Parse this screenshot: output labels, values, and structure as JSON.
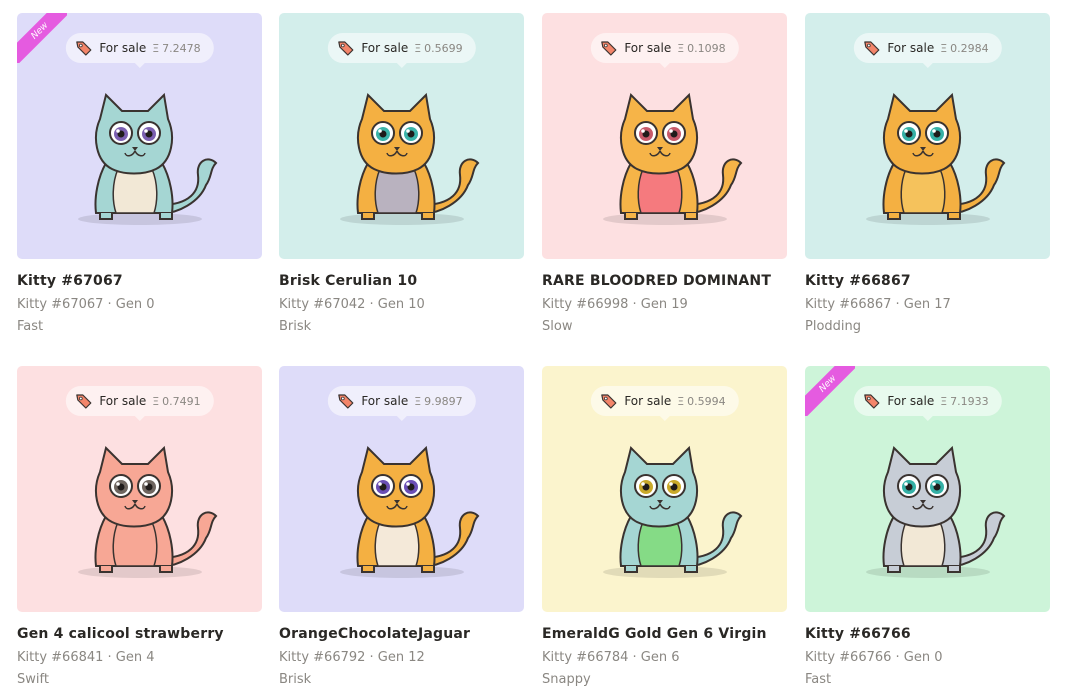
{
  "sale_label": "For sale",
  "eth_symbol": "Ξ",
  "new_label": "New",
  "kitties": [
    {
      "name": "Kitty #67067",
      "id_gen": "Kitty #67067 · Gen 0",
      "speed": "Fast",
      "price": "7.2478",
      "bg": "#dedcf9",
      "body": "#a5d6d3",
      "belly": "#f2e8d6",
      "eye": "#7b5fb1",
      "is_new": true
    },
    {
      "name": "Brisk Cerulian 10",
      "id_gen": "Kitty #67042 · Gen 10",
      "speed": "Brisk",
      "price": "0.5699",
      "bg": "#d3eeeb",
      "body": "#f4b042",
      "belly": "#b9b2bf",
      "eye": "#3bb3a9",
      "is_new": false
    },
    {
      "name": "RARE BLOODRED DOMINANT",
      "id_gen": "Kitty #66998 · Gen 19",
      "speed": "Slow",
      "price": "0.1098",
      "bg": "#fde0e1",
      "body": "#f6b448",
      "belly": "#f57a7e",
      "eye": "#c85a6a",
      "is_new": false
    },
    {
      "name": "Kitty #66867",
      "id_gen": "Kitty #66867 · Gen 17",
      "speed": "Plodding",
      "price": "0.2984",
      "bg": "#d3eeeb",
      "body": "#f4b042",
      "belly": "#f5c25c",
      "eye": "#35b0a6",
      "is_new": false
    },
    {
      "name": "Gen 4 calicool strawberry",
      "id_gen": "Kitty #66841 · Gen 4",
      "speed": "Swift",
      "price": "0.7491",
      "bg": "#fde0e1",
      "body": "#f7a795",
      "belly": "#f7a795",
      "eye": "#6f6660",
      "is_new": false
    },
    {
      "name": "OrangeChocolateJaguar",
      "id_gen": "Kitty #66792 · Gen 12",
      "speed": "Brisk",
      "price": "9.9897",
      "bg": "#dedcf9",
      "body": "#f4b042",
      "belly": "#f4e9d9",
      "eye": "#6b4fb5",
      "is_new": false
    },
    {
      "name": "EmeraldG Gold Gen 6 Virgin",
      "id_gen": "Kitty #66784 · Gen 6",
      "speed": "Snappy",
      "price": "0.5994",
      "bg": "#fbf4cd",
      "body": "#a5d6d3",
      "belly": "#85db86",
      "eye": "#c9a92a",
      "is_new": false
    },
    {
      "name": "Kitty #66766",
      "id_gen": "Kitty #66766 · Gen 0",
      "speed": "Fast",
      "price": "7.1933",
      "bg": "#cdf4d9",
      "body": "#c7cdd6",
      "belly": "#f2e8d6",
      "eye": "#35b0a6",
      "is_new": true
    }
  ]
}
